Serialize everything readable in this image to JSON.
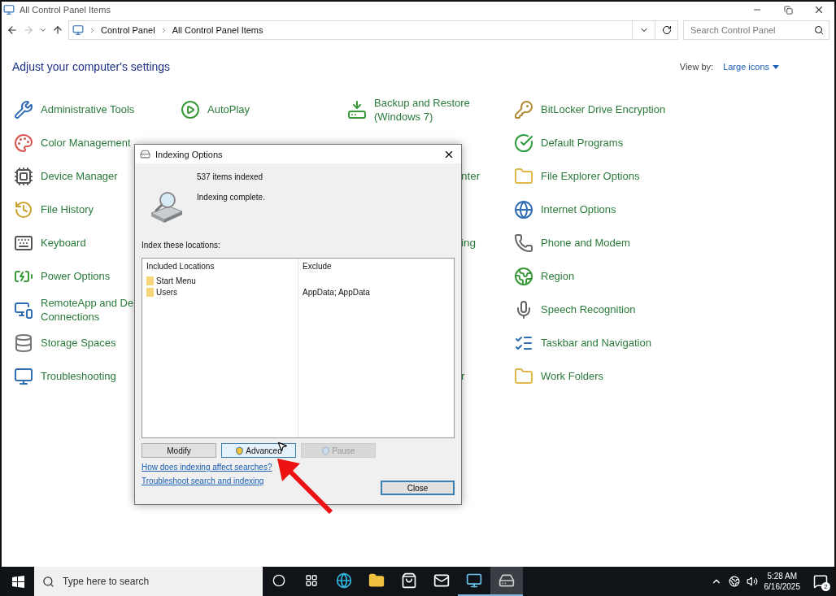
{
  "window": {
    "title": "All Control Panel Items"
  },
  "nav": {
    "breadcrumb": [
      "Control Panel",
      "All Control Panel Items"
    ],
    "search": {
      "placeholder": "Search Control Panel"
    }
  },
  "header": {
    "title": "Adjust your computer's settings",
    "view_by_label": "View by:",
    "view_by_value": "Large icons"
  },
  "columns": [
    [
      {
        "kind": "item",
        "label": "Administrative Tools"
      },
      {
        "kind": "item",
        "label": "Color Management"
      },
      {
        "kind": "item",
        "label": "Device Manager"
      },
      {
        "kind": "item",
        "label": "File History"
      },
      {
        "kind": "item",
        "label": "Keyboard"
      },
      {
        "kind": "item",
        "label": "Power Options"
      },
      {
        "kind": "item",
        "label": "RemoteApp and De\nConnections"
      },
      {
        "kind": "item",
        "label": "Storage Spaces"
      },
      {
        "kind": "item",
        "label": "Troubleshooting"
      }
    ],
    [
      {
        "kind": "item",
        "label": "AutoPlay"
      }
    ],
    [
      {
        "kind": "item",
        "label": "Backup and Restore\n(Windows 7)"
      },
      null,
      {
        "kind": "fragment",
        "label": "nter"
      },
      null,
      {
        "kind": "fragment",
        "label": "ing"
      },
      null,
      null,
      null,
      {
        "kind": "fragment",
        "label": "r"
      }
    ],
    [
      {
        "kind": "item",
        "label": "BitLocker Drive Encryption"
      },
      {
        "kind": "item",
        "label": "Default Programs"
      },
      {
        "kind": "item",
        "label": "File Explorer Options"
      },
      {
        "kind": "item",
        "label": "Internet Options"
      },
      {
        "kind": "item",
        "label": "Phone and Modem"
      },
      {
        "kind": "item",
        "label": "Region"
      },
      {
        "kind": "item",
        "label": "Speech Recognition"
      },
      {
        "kind": "item",
        "label": "Taskbar and Navigation"
      },
      {
        "kind": "item",
        "label": "Work Folders"
      }
    ]
  ],
  "dialog": {
    "title": "Indexing Options",
    "count": "537 items indexed",
    "status": "Indexing complete.",
    "locations_label": "Index these locations:",
    "table": {
      "columns": [
        "Included Locations",
        "Exclude"
      ],
      "rows": [
        {
          "location": "Start Menu"
        },
        {
          "location": "Users",
          "exclude": "AppData; AppData"
        }
      ]
    },
    "buttons": [
      {
        "label": "Modify",
        "shield": false,
        "hovered": false,
        "disabled": false
      },
      {
        "label": "Advanced",
        "shield": true,
        "hovered": true,
        "disabled": false
      },
      {
        "label": "Pause",
        "shield": true,
        "hovered": false,
        "disabled": true
      }
    ],
    "links": [
      "How does indexing affect searches?",
      "Troubleshoot search and indexing"
    ],
    "close_button": "Close"
  },
  "taskbar": {
    "search_placeholder": "Type here to search",
    "apps": [
      {
        "kind": "cortana",
        "running": false,
        "selected": false
      },
      {
        "kind": "taskview",
        "running": false,
        "selected": false
      },
      {
        "kind": "edge",
        "running": false,
        "selected": false
      },
      {
        "kind": "explorer",
        "running": false,
        "selected": false
      },
      {
        "kind": "store",
        "running": false,
        "selected": false
      },
      {
        "kind": "mail",
        "running": false,
        "selected": false
      },
      {
        "kind": "controlpanel",
        "running": true,
        "selected": false
      },
      {
        "kind": "indexing",
        "running": true,
        "selected": true
      }
    ],
    "time": "5:28 AM",
    "date": "6/16/2025",
    "notifications": "2"
  }
}
